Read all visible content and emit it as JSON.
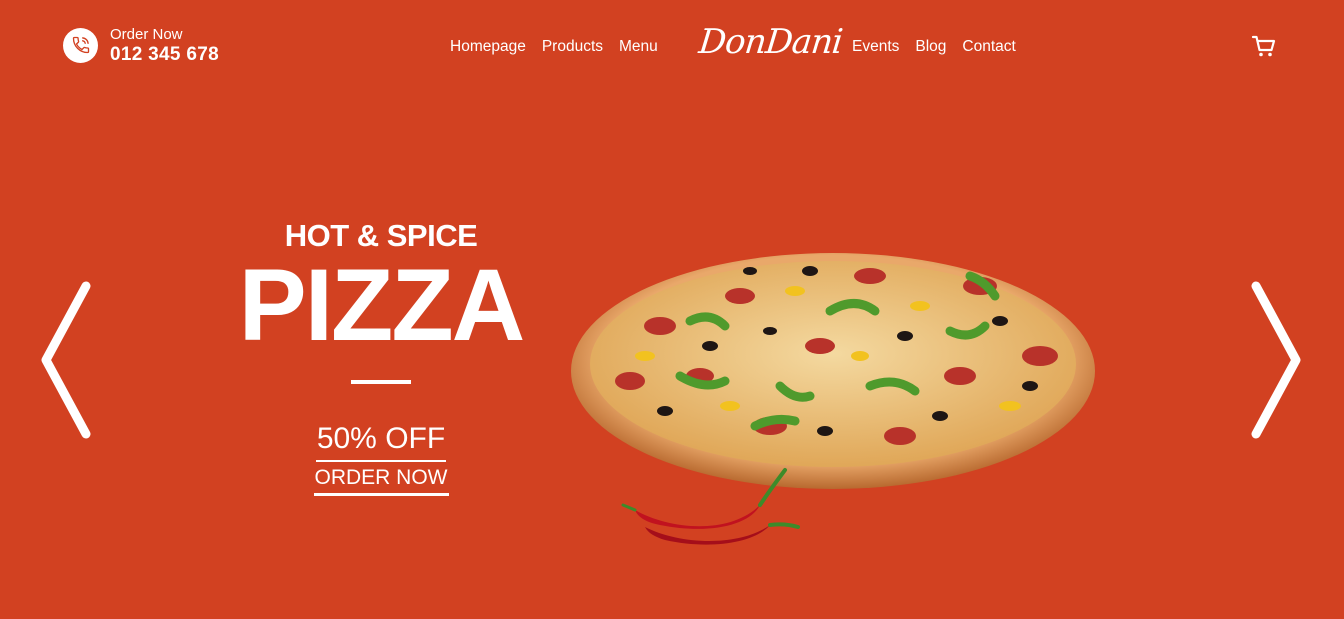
{
  "header": {
    "order_label": "Order Now",
    "order_phone": "012 345 678",
    "logo": "DonDani",
    "nav_left": [
      "Homepage",
      "Products",
      "Menu"
    ],
    "nav_right": [
      "Events",
      "Blog",
      "Contact"
    ]
  },
  "hero": {
    "subtitle": "HOT & SPICE",
    "title": "PIZZA",
    "discount": "50% OFF",
    "cta": "ORDER NOW"
  },
  "colors": {
    "background": "#d24121",
    "text": "#ffffff"
  },
  "icons": [
    "phone-icon",
    "cart-icon",
    "chevron-left-icon",
    "chevron-right-icon"
  ]
}
